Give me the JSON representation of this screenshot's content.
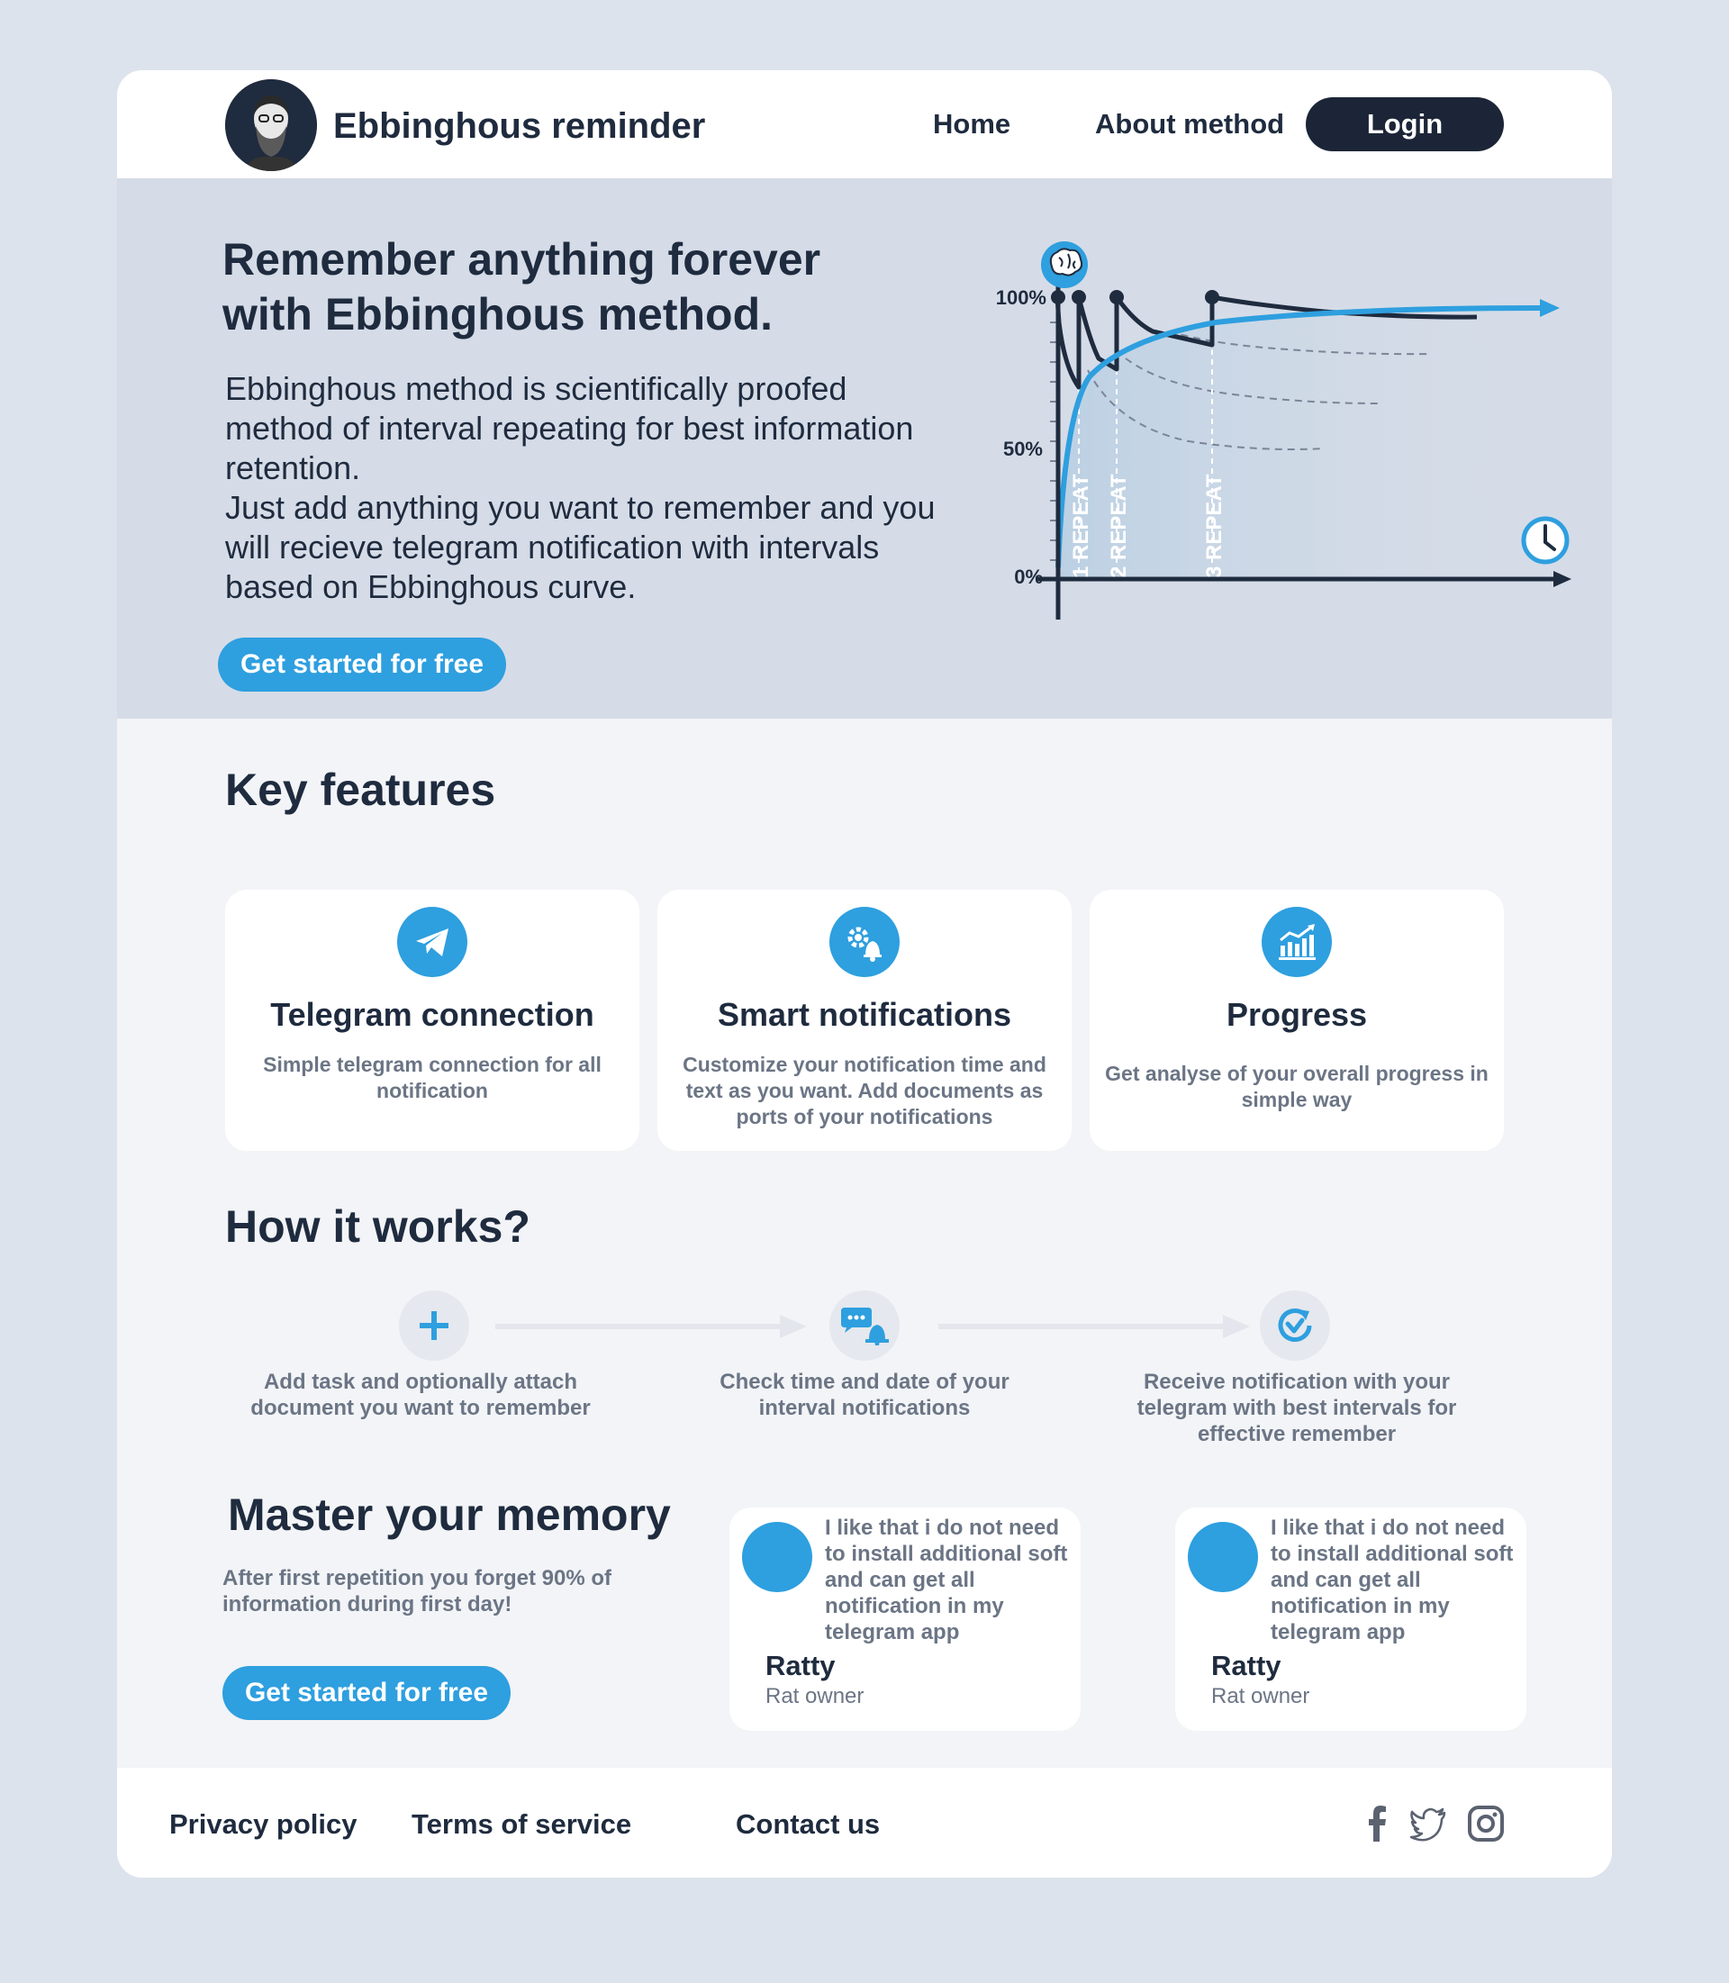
{
  "header": {
    "brand": "Ebbinghous reminder",
    "nav": {
      "home": "Home",
      "about": "About method",
      "login": "Login"
    }
  },
  "hero": {
    "title": "Remember anything forever with Ebbinghous method.",
    "description": "Ebbinghous method is scientifically proofed method of interval repeating for best information retention.\nJust add anything you want to remember and you will recieve telegram notification with intervals based on Ebbinghous curve.",
    "cta": "Get started for free",
    "chart": {
      "y_labels": [
        "100%",
        "50%",
        "0%"
      ],
      "repeat_labels": [
        "1 REPEAT",
        "2 REPEAT",
        "3 REPEAT"
      ]
    }
  },
  "features": {
    "title": "Key features",
    "cards": [
      {
        "title": "Telegram connection",
        "text": "Simple telegram connection for all notification",
        "icon": "telegram-icon"
      },
      {
        "title": "Smart notifications",
        "text": "Customize your notification time and text as you want. Add documents as ports of your notifications",
        "icon": "gear-bell-icon"
      },
      {
        "title": "Progress",
        "text": "Get analyse of your overall  progress in simple way",
        "icon": "chart-growth-icon"
      }
    ]
  },
  "how": {
    "title": "How it works?",
    "steps": [
      {
        "text": "Add task and optionally attach document you want to remember",
        "icon": "plus-icon"
      },
      {
        "text": "Check time and date of your interval notifications",
        "icon": "chat-bell-icon"
      },
      {
        "text": "Receive notification with your telegram with best intervals for effective remember",
        "icon": "refresh-check-icon"
      }
    ]
  },
  "master": {
    "title": "Master your memory",
    "text": "After first repetition you forget 90% of information during first day!",
    "cta": "Get started for free"
  },
  "reviews": [
    {
      "text": "I like that i do not need to install additional soft and can get all notification in my telegram app",
      "name": "Ratty",
      "role": "Rat owner"
    },
    {
      "text": "I like that i do not need to install additional soft and can get all notification in my telegram app",
      "name": "Ratty",
      "role": "Rat owner"
    }
  ],
  "footer": {
    "links": [
      "Privacy policy",
      "Terms of service",
      "Contact us"
    ],
    "social": [
      "facebook-icon",
      "twitter-icon",
      "instagram-icon"
    ]
  },
  "colors": {
    "accent": "#2e9fdf",
    "dark": "#1c2537",
    "hero_bg": "#d5dce7",
    "page_bg": "#f2f4f7",
    "body_bg": "#dde3ec"
  }
}
